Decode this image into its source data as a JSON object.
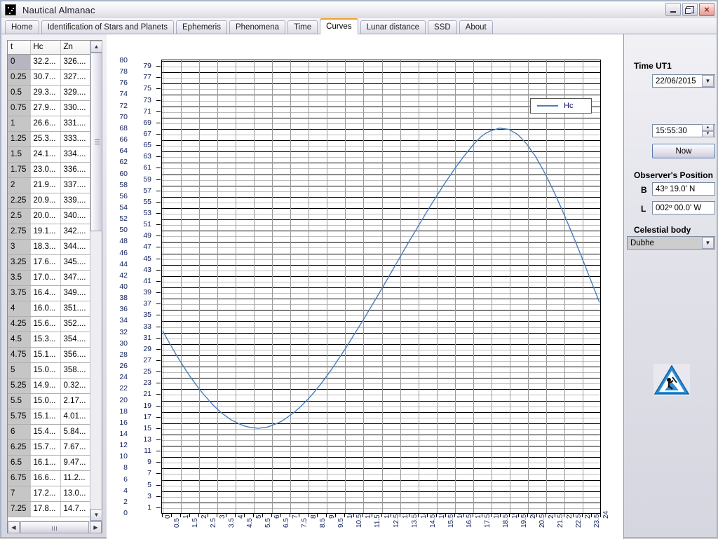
{
  "window": {
    "title": "Nautical Almanac",
    "icon": "almanac-icon",
    "minimize_label": "Minimize",
    "maximize_label": "Restore",
    "close_label": "×"
  },
  "tabs": [
    {
      "label": "Home",
      "active": false
    },
    {
      "label": "Identification of Stars and Planets",
      "active": false
    },
    {
      "label": "Ephemeris",
      "active": false
    },
    {
      "label": "Phenomena",
      "active": false
    },
    {
      "label": "Time",
      "active": false
    },
    {
      "label": "Curves",
      "active": true
    },
    {
      "label": "Lunar distance",
      "active": false
    },
    {
      "label": "SSD",
      "active": false
    },
    {
      "label": "About",
      "active": false
    }
  ],
  "grid": {
    "columns": [
      "t",
      "Hc",
      "Zn"
    ],
    "selected_row": 0,
    "rows": [
      [
        "0",
        "32.2...",
        "326...."
      ],
      [
        "0.25",
        "30.7...",
        "327...."
      ],
      [
        "0.5",
        "29.3...",
        "329...."
      ],
      [
        "0.75",
        "27.9...",
        "330...."
      ],
      [
        "1",
        "26.6...",
        "331...."
      ],
      [
        "1.25",
        "25.3...",
        "333...."
      ],
      [
        "1.5",
        "24.1...",
        "334...."
      ],
      [
        "1.75",
        "23.0...",
        "336...."
      ],
      [
        "2",
        "21.9...",
        "337...."
      ],
      [
        "2.25",
        "20.9...",
        "339...."
      ],
      [
        "2.5",
        "20.0...",
        "340...."
      ],
      [
        "2.75",
        "19.1...",
        "342...."
      ],
      [
        "3",
        "18.3...",
        "344...."
      ],
      [
        "3.25",
        "17.6...",
        "345...."
      ],
      [
        "3.5",
        "17.0...",
        "347...."
      ],
      [
        "3.75",
        "16.4...",
        "349...."
      ],
      [
        "4",
        "16.0...",
        "351...."
      ],
      [
        "4.25",
        "15.6...",
        "352...."
      ],
      [
        "4.5",
        "15.3...",
        "354...."
      ],
      [
        "4.75",
        "15.1...",
        "356...."
      ],
      [
        "5",
        "15.0...",
        "358...."
      ],
      [
        "5.25",
        "14.9...",
        "0.32..."
      ],
      [
        "5.5",
        "15.0...",
        "2.17..."
      ],
      [
        "5.75",
        "15.1...",
        "4.01..."
      ],
      [
        "6",
        "15.4...",
        "5.84..."
      ],
      [
        "6.25",
        "15.7...",
        "7.67..."
      ],
      [
        "6.5",
        "16.1...",
        "9.47..."
      ],
      [
        "6.75",
        "16.6...",
        "11.2..."
      ],
      [
        "7",
        "17.2...",
        "13.0..."
      ],
      [
        "7.25",
        "17.8...",
        "14.7..."
      ]
    ]
  },
  "side": {
    "time_group_label": "Time UT1",
    "date_value": "22/06/2015",
    "time_value": "15:55:30",
    "now_button": "Now",
    "position_group_label": "Observer's Position",
    "lat_letter": "B",
    "lat_value": "43º 19.0' N",
    "lon_letter": "L",
    "lon_value": "002º 00.0' W",
    "body_group_label": "Celestial body",
    "body_value": "Dubhe",
    "work_icon": "under-construction-icon"
  },
  "chart_data": {
    "type": "line",
    "title": "",
    "xlabel": "",
    "ylabel": "",
    "xlim": [
      0,
      24
    ],
    "ylim": [
      0,
      80
    ],
    "grid": true,
    "legend_position": "top-right",
    "x_tick_step": 0.5,
    "y_tick_step": 1,
    "y_ticks_outer": [
      80,
      78,
      76,
      74,
      72,
      70,
      68,
      66,
      64,
      62,
      60,
      58,
      56,
      54,
      52,
      50,
      48,
      46,
      44,
      42,
      40,
      38,
      36,
      34,
      32,
      30,
      28,
      26,
      24,
      22,
      20,
      18,
      16,
      14,
      12,
      10,
      8,
      6,
      4,
      2,
      0
    ],
    "y_ticks_inner": [
      79,
      77,
      75,
      73,
      71,
      69,
      67,
      65,
      63,
      61,
      59,
      57,
      55,
      53,
      51,
      49,
      47,
      45,
      43,
      41,
      39,
      37,
      35,
      33,
      31,
      29,
      27,
      25,
      23,
      21,
      19,
      17,
      15,
      13,
      11,
      9,
      7,
      5,
      3,
      1
    ],
    "x_ticks": [
      0,
      0.5,
      1,
      1.5,
      2,
      2.5,
      3,
      3.5,
      4,
      4.5,
      5,
      5.5,
      6,
      6.5,
      7,
      7.5,
      8,
      8.5,
      9,
      9.5,
      10,
      10.5,
      11,
      11.5,
      12,
      12.5,
      13,
      13.5,
      14,
      14.5,
      15,
      15.5,
      16,
      16.5,
      17,
      17.5,
      18,
      18.5,
      19,
      19.5,
      20,
      20.5,
      21,
      21.5,
      22,
      22.5,
      23,
      23.5,
      24
    ],
    "series": [
      {
        "name": "Hc",
        "color": "#4a7ebb",
        "x": [
          0,
          0.25,
          0.5,
          0.75,
          1,
          1.25,
          1.5,
          1.75,
          2,
          2.25,
          2.5,
          2.75,
          3,
          3.25,
          3.5,
          3.75,
          4,
          4.25,
          4.5,
          4.75,
          5,
          5.25,
          5.5,
          5.75,
          6,
          6.25,
          6.5,
          6.75,
          7,
          7.25,
          7.5,
          7.75,
          8,
          8.25,
          8.5,
          8.75,
          9,
          9.25,
          9.5,
          9.75,
          10,
          10.5,
          11,
          11.5,
          12,
          12.5,
          13,
          13.5,
          14,
          14.5,
          15,
          15.5,
          16,
          16.5,
          17,
          17.25,
          17.5,
          17.75,
          18,
          18.5,
          19,
          19.5,
          20,
          20.5,
          21,
          21.5,
          22,
          22.5,
          23,
          23.5,
          24
        ],
        "y": [
          32.2,
          30.7,
          29.3,
          27.9,
          26.6,
          25.3,
          24.1,
          23.0,
          21.9,
          20.9,
          20.0,
          19.1,
          18.3,
          17.6,
          17.0,
          16.4,
          16.0,
          15.6,
          15.3,
          15.1,
          15.0,
          14.9,
          15.0,
          15.1,
          15.4,
          15.7,
          16.1,
          16.6,
          17.2,
          17.8,
          18.5,
          19.3,
          20.1,
          21.0,
          22.0,
          23.0,
          24.1,
          25.2,
          26.4,
          27.6,
          28.8,
          31.4,
          34.0,
          36.7,
          39.4,
          42.2,
          45.0,
          47.8,
          50.5,
          53.2,
          55.8,
          58.3,
          60.7,
          62.9,
          64.9,
          65.8,
          66.6,
          67.2,
          67.6,
          68.1,
          67.9,
          67.0,
          65.3,
          63.0,
          60.1,
          56.8,
          53.2,
          49.4,
          45.4,
          41.3,
          37.2
        ]
      }
    ]
  }
}
